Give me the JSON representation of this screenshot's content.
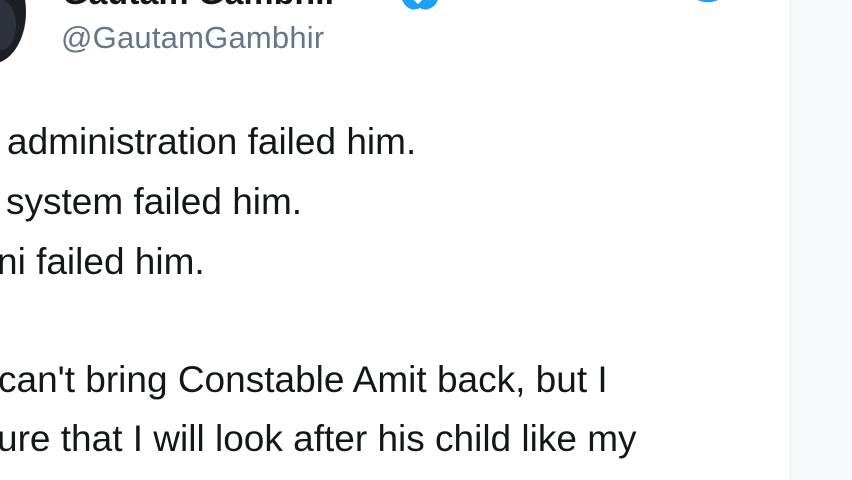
{
  "tweet": {
    "author": {
      "display_name": "Gautam Gambhir",
      "handle": "@GautamGambhir",
      "verified_icon": "verified-badge-icon",
      "avatar": "avatar"
    },
    "brand_icon": "twitter-bird-icon",
    "accent_color": "#1da1f2",
    "text_color": "#14171a",
    "muted_color": "#657786",
    "lines": [
      "administration failed him.",
      "system failed him.",
      "ni failed him.",
      "can't bring Constable Amit back, but I",
      "ure that I will look after his child like my"
    ]
  }
}
